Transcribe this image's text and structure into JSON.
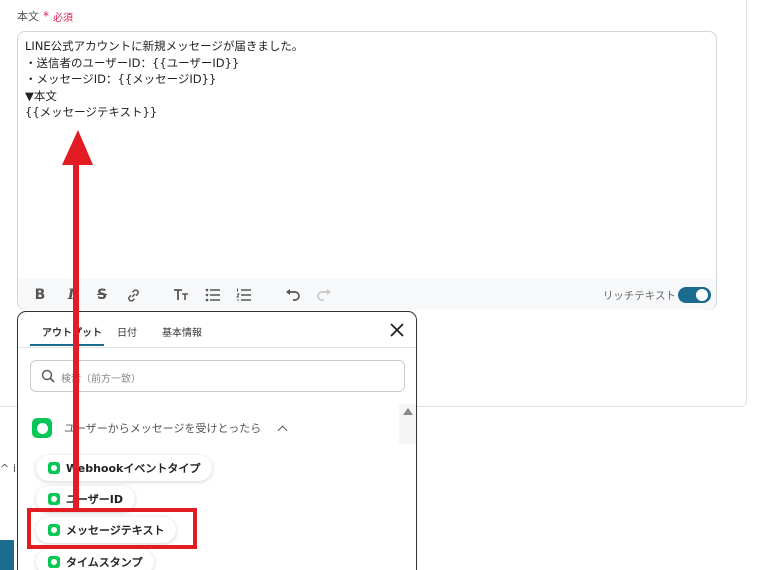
{
  "field": {
    "label": "本文",
    "required_star": "*",
    "required_text": "必須"
  },
  "editor": {
    "body": "LINE公式アカウントに新規メッセージが届きました。\n・送信者のユーザーID：{{ユーザーID}}\n・メッセージID：{{メッセージID}}\n▼本文\n{{メッセージテキスト}}",
    "toolbar": {
      "bold": "B",
      "italic": "I",
      "strike": "S",
      "rich_text_label": "リッチテキスト",
      "rich_text_enabled": true
    }
  },
  "panel": {
    "tabs": [
      "アウトプット",
      "日付",
      "基本情報"
    ],
    "active_tab": "アウトプット",
    "search_placeholder": "検索（前方一致）",
    "group_title": "ユーザーからメッセージを受けとったら",
    "items": [
      "Webhookイベントタイプ",
      "ユーザーID",
      "メッセージテキスト",
      "タイムスタンプ"
    ],
    "highlighted_item": "メッセージテキスト"
  },
  "colors": {
    "accent": "#1b6b8e",
    "required": "#e0204f",
    "line_green": "#06c755",
    "annotation_red": "#e31c23"
  }
}
